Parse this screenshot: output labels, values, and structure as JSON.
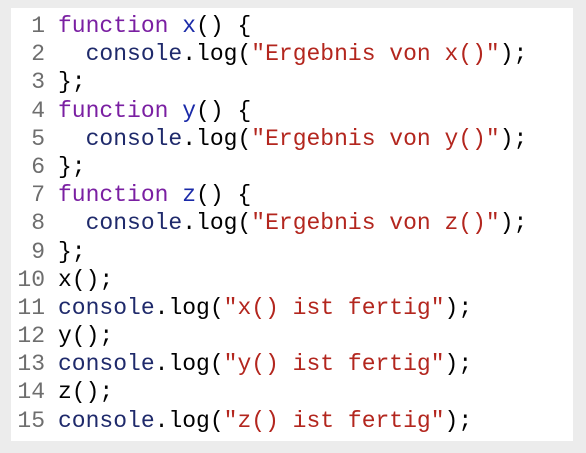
{
  "colors": {
    "keyword": "#7a1fa2",
    "function_name": "#1a2aa8",
    "variable": "#1f2a6b",
    "string": "#b3261e",
    "line_number": "#6e6e6e",
    "background": "#ffffff"
  },
  "code": {
    "lines": [
      {
        "number": "1",
        "tokens": [
          {
            "type": "keyword",
            "text": "function"
          },
          {
            "type": "punct",
            "text": " "
          },
          {
            "type": "name",
            "text": "x"
          },
          {
            "type": "punct",
            "text": "() {"
          }
        ]
      },
      {
        "number": "2",
        "tokens": [
          {
            "type": "punct",
            "text": "  "
          },
          {
            "type": "variable",
            "text": "console"
          },
          {
            "type": "punct",
            "text": "."
          },
          {
            "type": "property",
            "text": "log"
          },
          {
            "type": "punct",
            "text": "("
          },
          {
            "type": "string",
            "text": "\"Ergebnis von x()\""
          },
          {
            "type": "punct",
            "text": ");"
          }
        ]
      },
      {
        "number": "3",
        "tokens": [
          {
            "type": "punct",
            "text": "};"
          }
        ]
      },
      {
        "number": "4",
        "tokens": [
          {
            "type": "keyword",
            "text": "function"
          },
          {
            "type": "punct",
            "text": " "
          },
          {
            "type": "name",
            "text": "y"
          },
          {
            "type": "punct",
            "text": "() {"
          }
        ]
      },
      {
        "number": "5",
        "tokens": [
          {
            "type": "punct",
            "text": "  "
          },
          {
            "type": "variable",
            "text": "console"
          },
          {
            "type": "punct",
            "text": "."
          },
          {
            "type": "property",
            "text": "log"
          },
          {
            "type": "punct",
            "text": "("
          },
          {
            "type": "string",
            "text": "\"Ergebnis von y()\""
          },
          {
            "type": "punct",
            "text": ");"
          }
        ]
      },
      {
        "number": "6",
        "tokens": [
          {
            "type": "punct",
            "text": "};"
          }
        ]
      },
      {
        "number": "7",
        "tokens": [
          {
            "type": "keyword",
            "text": "function"
          },
          {
            "type": "punct",
            "text": " "
          },
          {
            "type": "name",
            "text": "z"
          },
          {
            "type": "punct",
            "text": "() {"
          }
        ]
      },
      {
        "number": "8",
        "tokens": [
          {
            "type": "punct",
            "text": "  "
          },
          {
            "type": "variable",
            "text": "console"
          },
          {
            "type": "punct",
            "text": "."
          },
          {
            "type": "property",
            "text": "log"
          },
          {
            "type": "punct",
            "text": "("
          },
          {
            "type": "string",
            "text": "\"Ergebnis von z()\""
          },
          {
            "type": "punct",
            "text": ");"
          }
        ]
      },
      {
        "number": "9",
        "tokens": [
          {
            "type": "punct",
            "text": "};"
          }
        ]
      },
      {
        "number": "10",
        "tokens": [
          {
            "type": "punct",
            "text": "x();"
          }
        ]
      },
      {
        "number": "11",
        "tokens": [
          {
            "type": "variable",
            "text": "console"
          },
          {
            "type": "punct",
            "text": "."
          },
          {
            "type": "property",
            "text": "log"
          },
          {
            "type": "punct",
            "text": "("
          },
          {
            "type": "string",
            "text": "\"x() ist fertig\""
          },
          {
            "type": "punct",
            "text": ");"
          }
        ]
      },
      {
        "number": "12",
        "tokens": [
          {
            "type": "punct",
            "text": "y();"
          }
        ]
      },
      {
        "number": "13",
        "tokens": [
          {
            "type": "variable",
            "text": "console"
          },
          {
            "type": "punct",
            "text": "."
          },
          {
            "type": "property",
            "text": "log"
          },
          {
            "type": "punct",
            "text": "("
          },
          {
            "type": "string",
            "text": "\"y() ist fertig\""
          },
          {
            "type": "punct",
            "text": ");"
          }
        ]
      },
      {
        "number": "14",
        "tokens": [
          {
            "type": "punct",
            "text": "z();"
          }
        ]
      },
      {
        "number": "15",
        "tokens": [
          {
            "type": "variable",
            "text": "console"
          },
          {
            "type": "punct",
            "text": "."
          },
          {
            "type": "property",
            "text": "log"
          },
          {
            "type": "punct",
            "text": "("
          },
          {
            "type": "string",
            "text": "\"z() ist fertig\""
          },
          {
            "type": "punct",
            "text": ");"
          }
        ]
      }
    ]
  }
}
